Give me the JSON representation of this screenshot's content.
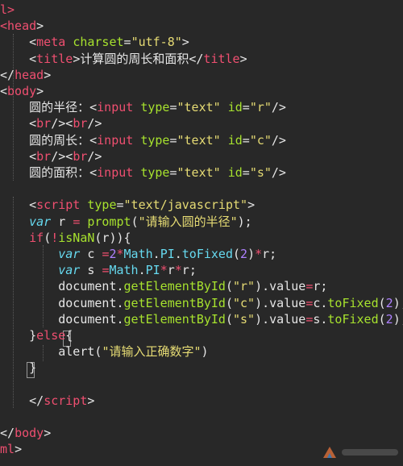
{
  "editor": {
    "lines": [
      [
        [
          "tag",
          "l>"
        ]
      ],
      [
        [
          "tag",
          "<head"
        ],
        [
          "punc",
          ">"
        ]
      ],
      [
        [
          "punc",
          "    <"
        ],
        [
          "tag",
          "meta"
        ],
        [
          "text",
          " "
        ],
        [
          "attr",
          "charset"
        ],
        [
          "punc",
          "="
        ],
        [
          "str",
          "\"utf-8\""
        ],
        [
          "punc",
          ">"
        ]
      ],
      [
        [
          "punc",
          "    <"
        ],
        [
          "tag",
          "title"
        ],
        [
          "punc",
          ">"
        ],
        [
          "text",
          "计算圆的周长和面积"
        ],
        [
          "punc",
          "</"
        ],
        [
          "tag",
          "title"
        ],
        [
          "punc",
          ">"
        ]
      ],
      [
        [
          "punc",
          "</"
        ],
        [
          "tag",
          "head"
        ],
        [
          "punc",
          ">"
        ]
      ],
      [
        [
          "punc",
          "<"
        ],
        [
          "tag",
          "body"
        ],
        [
          "punc",
          ">"
        ]
      ],
      [
        [
          "text",
          "    圆的半径："
        ],
        [
          "punc",
          "<"
        ],
        [
          "tag",
          "input"
        ],
        [
          "text",
          " "
        ],
        [
          "attr",
          "type"
        ],
        [
          "punc",
          "="
        ],
        [
          "str",
          "\"text\""
        ],
        [
          "text",
          " "
        ],
        [
          "attr",
          "id"
        ],
        [
          "punc",
          "="
        ],
        [
          "str",
          "\"r\""
        ],
        [
          "punc",
          "/>"
        ]
      ],
      [
        [
          "punc",
          "    <"
        ],
        [
          "tag",
          "br"
        ],
        [
          "punc",
          "/><"
        ],
        [
          "tag",
          "br"
        ],
        [
          "punc",
          "/>"
        ]
      ],
      [
        [
          "text",
          "    圆的周长："
        ],
        [
          "punc",
          "<"
        ],
        [
          "tag",
          "input"
        ],
        [
          "text",
          " "
        ],
        [
          "attr",
          "type"
        ],
        [
          "punc",
          "="
        ],
        [
          "str",
          "\"text\""
        ],
        [
          "text",
          " "
        ],
        [
          "attr",
          "id"
        ],
        [
          "punc",
          "="
        ],
        [
          "str",
          "\"c\""
        ],
        [
          "punc",
          "/>"
        ]
      ],
      [
        [
          "punc",
          "    <"
        ],
        [
          "tag",
          "br"
        ],
        [
          "punc",
          "/><"
        ],
        [
          "tag",
          "br"
        ],
        [
          "punc",
          "/>"
        ]
      ],
      [
        [
          "text",
          "    圆的面积："
        ],
        [
          "punc",
          "<"
        ],
        [
          "tag",
          "input"
        ],
        [
          "text",
          " "
        ],
        [
          "attr",
          "type"
        ],
        [
          "punc",
          "="
        ],
        [
          "str",
          "\"text\""
        ],
        [
          "text",
          " "
        ],
        [
          "attr",
          "id"
        ],
        [
          "punc",
          "="
        ],
        [
          "str",
          "\"s\""
        ],
        [
          "punc",
          "/>"
        ]
      ],
      [],
      [
        [
          "punc",
          "    <"
        ],
        [
          "tag",
          "script"
        ],
        [
          "text",
          " "
        ],
        [
          "attr",
          "type"
        ],
        [
          "punc",
          "="
        ],
        [
          "str",
          "\"text/javascript\""
        ],
        [
          "punc",
          ">"
        ]
      ],
      [
        [
          "text",
          "    "
        ],
        [
          "var",
          "var"
        ],
        [
          "text",
          " "
        ],
        [
          "ident",
          "r"
        ],
        [
          "text",
          " "
        ],
        [
          "op",
          "="
        ],
        [
          "text",
          " "
        ],
        [
          "fn",
          "prompt"
        ],
        [
          "punc",
          "("
        ],
        [
          "str",
          "\"请输入圆的半径\""
        ],
        [
          "punc",
          ");"
        ]
      ],
      [
        [
          "text",
          "    "
        ],
        [
          "kw",
          "if"
        ],
        [
          "punc",
          "("
        ],
        [
          "op",
          "!"
        ],
        [
          "fn",
          "isNaN"
        ],
        [
          "punc",
          "("
        ],
        [
          "ident",
          "r"
        ],
        [
          "punc",
          "))"
        ],
        [
          "punc",
          "{"
        ]
      ],
      [
        [
          "text",
          "        "
        ],
        [
          "var",
          "var"
        ],
        [
          "text",
          " "
        ],
        [
          "ident",
          "c"
        ],
        [
          "text",
          " "
        ],
        [
          "op",
          "="
        ],
        [
          "num",
          "2"
        ],
        [
          "op",
          "*"
        ],
        [
          "prop",
          "Math"
        ],
        [
          "punc",
          "."
        ],
        [
          "prop",
          "PI"
        ],
        [
          "punc",
          "."
        ],
        [
          "prop",
          "toFixed"
        ],
        [
          "punc",
          "("
        ],
        [
          "num",
          "2"
        ],
        [
          "punc",
          ")"
        ],
        [
          "op",
          "*"
        ],
        [
          "ident",
          "r"
        ],
        [
          "punc",
          ";"
        ]
      ],
      [
        [
          "text",
          "        "
        ],
        [
          "var",
          "var"
        ],
        [
          "text",
          " "
        ],
        [
          "ident",
          "s"
        ],
        [
          "text",
          " "
        ],
        [
          "op",
          "="
        ],
        [
          "prop",
          "Math"
        ],
        [
          "punc",
          "."
        ],
        [
          "prop",
          "PI"
        ],
        [
          "op",
          "*"
        ],
        [
          "ident",
          "r"
        ],
        [
          "op",
          "*"
        ],
        [
          "ident",
          "r"
        ],
        [
          "punc",
          ";"
        ]
      ],
      [
        [
          "text",
          "        "
        ],
        [
          "ident",
          "document"
        ],
        [
          "punc",
          "."
        ],
        [
          "fn",
          "getElementById"
        ],
        [
          "punc",
          "("
        ],
        [
          "str",
          "\"r\""
        ],
        [
          "punc",
          ")."
        ],
        [
          "ident",
          "value"
        ],
        [
          "op",
          "="
        ],
        [
          "ident",
          "r"
        ],
        [
          "punc",
          ";"
        ]
      ],
      [
        [
          "text",
          "        "
        ],
        [
          "ident",
          "document"
        ],
        [
          "punc",
          "."
        ],
        [
          "fn",
          "getElementById"
        ],
        [
          "punc",
          "("
        ],
        [
          "str",
          "\"c\""
        ],
        [
          "punc",
          ")."
        ],
        [
          "ident",
          "value"
        ],
        [
          "op",
          "="
        ],
        [
          "ident",
          "c"
        ],
        [
          "punc",
          "."
        ],
        [
          "fn",
          "toFixed"
        ],
        [
          "punc",
          "("
        ],
        [
          "num",
          "2"
        ],
        [
          "punc",
          ");"
        ]
      ],
      [
        [
          "text",
          "        "
        ],
        [
          "ident",
          "document"
        ],
        [
          "punc",
          "."
        ],
        [
          "fn",
          "getElementById"
        ],
        [
          "punc",
          "("
        ],
        [
          "str",
          "\"s\""
        ],
        [
          "punc",
          ")."
        ],
        [
          "ident",
          "value"
        ],
        [
          "op",
          "="
        ],
        [
          "ident",
          "s"
        ],
        [
          "punc",
          "."
        ],
        [
          "fn",
          "toFixed"
        ],
        [
          "punc",
          "("
        ],
        [
          "num",
          "2"
        ],
        [
          "punc",
          ");"
        ]
      ],
      [
        [
          "text",
          "    "
        ],
        [
          "punc",
          "}"
        ],
        [
          "kw",
          "else"
        ],
        [
          "punc",
          "{"
        ]
      ],
      [
        [
          "text",
          "        "
        ],
        [
          "ident",
          "alert"
        ],
        [
          "punc",
          "("
        ],
        [
          "str",
          "\"请输入正确数字\""
        ],
        [
          "punc",
          ")"
        ]
      ],
      [
        [
          "text",
          "    "
        ],
        [
          "punc",
          "}"
        ]
      ],
      [],
      [
        [
          "punc",
          "    </"
        ],
        [
          "tag",
          "script"
        ],
        [
          "punc",
          ">"
        ]
      ],
      [],
      [
        [
          "punc",
          "</"
        ],
        [
          "tag",
          "body"
        ],
        [
          "punc",
          ">"
        ]
      ],
      [
        [
          "tag",
          "ml"
        ],
        [
          "punc",
          ">"
        ]
      ]
    ]
  },
  "colors": {
    "background": "#282828",
    "tag": "#ef4f70",
    "attribute": "#a7e22e",
    "string": "#e6db74",
    "number": "#ae81ff",
    "property": "#66d9ef"
  }
}
